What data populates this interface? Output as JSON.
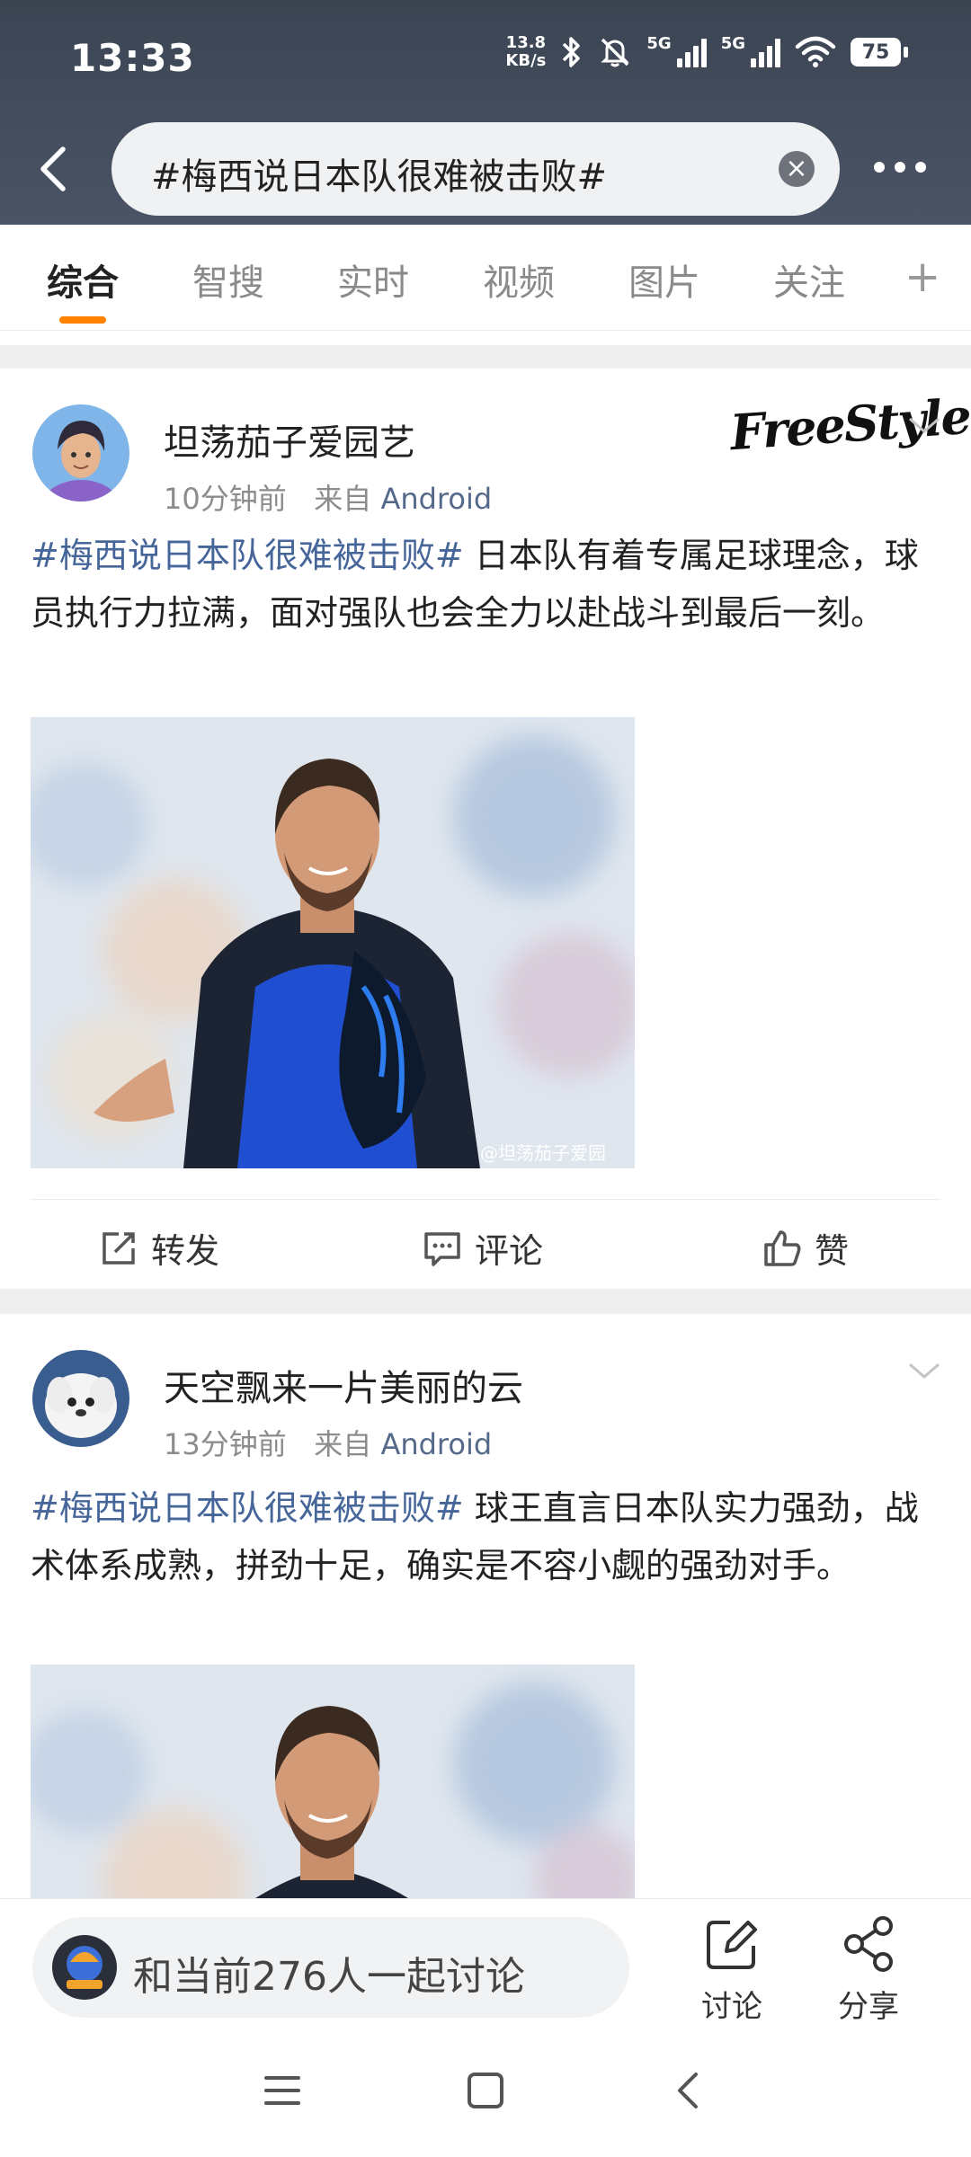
{
  "status": {
    "time": "13:33",
    "speed_value": "13.8",
    "speed_unit": "KB/s",
    "net1": "5G",
    "net2": "5G",
    "wifi_sub": "6",
    "battery": "75"
  },
  "search": {
    "query": "#梅西说日本队很难被击败#"
  },
  "tabs": [
    {
      "label": "综合",
      "active": true
    },
    {
      "label": "智搜"
    },
    {
      "label": "实时"
    },
    {
      "label": "视频"
    },
    {
      "label": "图片"
    },
    {
      "label": "关注"
    }
  ],
  "tab_add": "+",
  "posts": [
    {
      "user": "坦荡茄子爱园艺",
      "time": "10分钟前",
      "from": "来自",
      "source": "Android",
      "badge": "FreeStyle",
      "topic": "#梅西说日本队很难被击败#",
      "text": " 日本队有着专属足球理念，球员执行力拉满，面对强队也会全力以赴战斗到最后一刻。",
      "watermark": "@坦荡茄子爱园",
      "actions": {
        "repost": "转发",
        "comment": "评论",
        "like": "赞"
      }
    },
    {
      "user": "天空飘来一片美丽的云",
      "time": "13分钟前",
      "from": "来自",
      "source": "Android",
      "topic": "#梅西说日本队很难被击败#",
      "text": " 球王直言日本队实力强劲，战术体系成熟，拼劲十足，确实是不容小觑的强劲对手。"
    }
  ],
  "bottom": {
    "discuss_placeholder": "和当前276人一起讨论",
    "discuss_label": "讨论",
    "share_label": "分享"
  },
  "colors": {
    "accent": "#ff8200",
    "topic": "#46669a",
    "header": "#3b4452"
  }
}
